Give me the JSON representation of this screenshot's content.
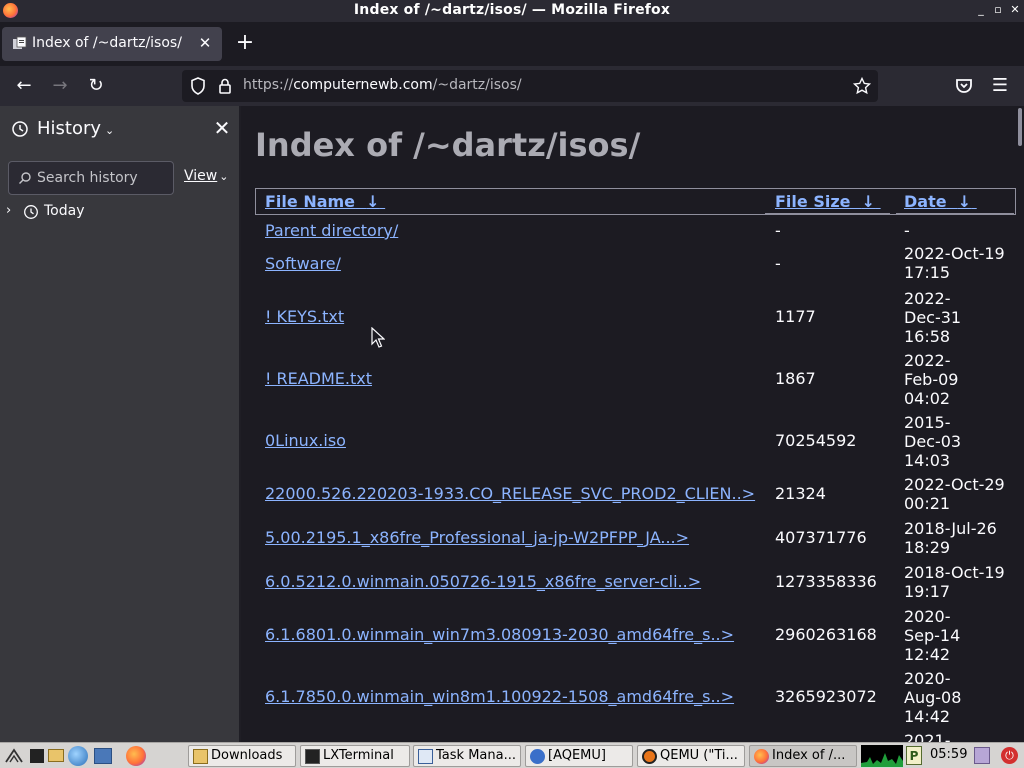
{
  "window": {
    "title": "Index of /~dartz/isos/ — Mozilla Firefox"
  },
  "tab": {
    "label": "Index of /~dartz/isos/"
  },
  "urlbar": {
    "url_prefix": "https://",
    "url_host": "computernewb.com",
    "url_path": "/~dartz/isos/"
  },
  "sidebar": {
    "title": "History",
    "search_placeholder": "Search history",
    "view_label": "View",
    "tree": [
      {
        "label": "Today"
      }
    ]
  },
  "page": {
    "heading": "Index of /~dartz/isos/",
    "columns": {
      "name": "File Name",
      "size": "File Size",
      "date": "Date",
      "sort_arrow": "↓"
    },
    "rows": [
      {
        "name": "Parent directory/",
        "size": "-",
        "date": "-"
      },
      {
        "name": "Software/",
        "size": "-",
        "date": "2022-Oct-19 17:15"
      },
      {
        "name": "! KEYS.txt",
        "size": "1177",
        "date": "2022-Dec-31 16:58"
      },
      {
        "name": "! README.txt",
        "size": "1867",
        "date": "2022-Feb-09 04:02"
      },
      {
        "name": "0Linux.iso",
        "size": "70254592",
        "date": "2015-Dec-03 14:03"
      },
      {
        "name": "22000.526.220203-1933.CO_RELEASE_SVC_PROD2_CLIEN..>",
        "size": "21324",
        "date": "2022-Oct-29 00:21"
      },
      {
        "name": "5.00.2195.1_x86fre_Professional_ja-jp-W2PFPP_JA...>",
        "size": "407371776",
        "date": "2018-Jul-26 18:29"
      },
      {
        "name": "6.0.5212.0.winmain.050726-1915_x86fre_server-cli..>",
        "size": "1273358336",
        "date": "2018-Oct-19 19:17"
      },
      {
        "name": "6.1.6801.0.winmain_win7m3.080913-2030_amd64fre_s..>",
        "size": "2960263168",
        "date": "2020-Sep-14 12:42"
      },
      {
        "name": "6.1.7850.0.winmain_win8m1.100922-1508_amd64fre_s..>",
        "size": "3265923072",
        "date": "2020-Aug-08 14:42"
      },
      {
        "name": "",
        "size": "",
        "date": "2021-"
      }
    ]
  },
  "taskbar": {
    "tasks": [
      {
        "label": "Downloads",
        "icon": "folder-icon"
      },
      {
        "label": "LXTerminal",
        "icon": "terminal-icon"
      },
      {
        "label": "Task Mana...",
        "icon": "task-manager-icon"
      },
      {
        "label": "[AQEMU]",
        "icon": "aqemu-icon"
      },
      {
        "label": "QEMU (\"Ti...",
        "icon": "qemu-icon"
      },
      {
        "label": "Index of /...",
        "icon": "firefox-icon"
      }
    ],
    "clock": "05:59"
  },
  "colors": {
    "link": "#8cb4ff",
    "sidebar_bg": "#38383d",
    "content_bg": "#1c1b22",
    "chrome_bg": "#2b2a33"
  }
}
